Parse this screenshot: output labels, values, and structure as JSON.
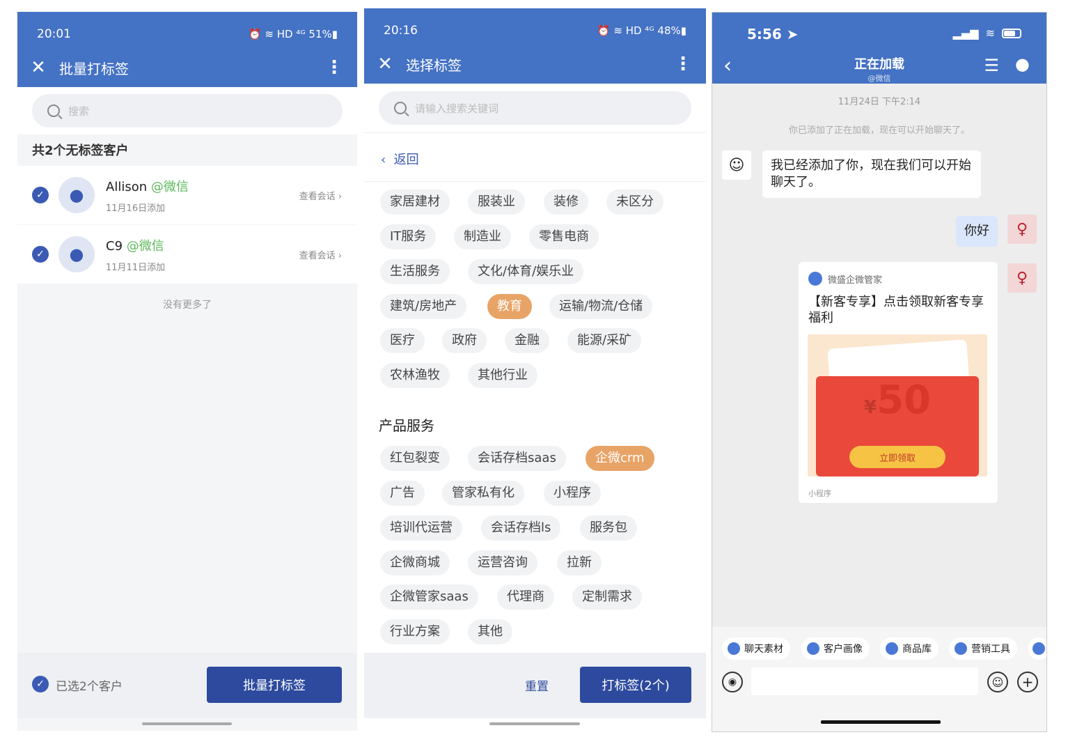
{
  "panel1": {
    "status": {
      "time": "20:01",
      "icons": "⏰ ≋ HD ⁴ᴳ 51%▮"
    },
    "title": "批量打标签",
    "search_placeholder": "搜索",
    "count_text": "共2个无标签客户",
    "customers": [
      {
        "name": "Allison",
        "source": "@微信",
        "added": "11月16日添加",
        "action": "查看会话"
      },
      {
        "name": "C9",
        "source": "@微信",
        "added": "11月11日添加",
        "action": "查看会话"
      }
    ],
    "no_more": "没有更多了",
    "selected": "已选2个客户",
    "batch_button": "批量打标签"
  },
  "panel2": {
    "status": {
      "time": "20:16",
      "icons": "⏰ ≋ HD ⁴ᴳ 48%▮"
    },
    "title": "选择标签",
    "search_placeholder": "请输入搜索关键词",
    "back": "返回",
    "industry_tags": [
      "家居建材",
      "服装业",
      "装修",
      "未区分",
      "IT服务",
      "制造业",
      "零售电商",
      "生活服务",
      "文化/体育/娱乐业",
      "建筑/房地产",
      "教育",
      "运输/物流/仓储",
      "医疗",
      "政府",
      "金融",
      "能源/采矿",
      "农林渔牧",
      "其他行业"
    ],
    "section_title": "产品服务",
    "product_tags": [
      "红包裂变",
      "会话存档saas",
      "企微crm",
      "广告",
      "管家私有化",
      "小程序",
      "培训代运营",
      "会话存档ls",
      "服务包",
      "企微商城",
      "运营咨询",
      "拉新",
      "企微管家saas",
      "代理商",
      "定制需求",
      "行业方案",
      "其他"
    ],
    "selected_tags": [
      "教育",
      "企微crm"
    ],
    "reset": "重置",
    "apply": "打标签(2个)"
  },
  "panel3": {
    "status": {
      "time": "5:56"
    },
    "title": "正在加载",
    "subtitle": "@微信",
    "timestamp": "11月24日 下午2:14",
    "system_msg": "你已添加了正在加载，现在可以开始聊天了。",
    "msg_in": "我已经添加了你，现在我们可以开始聊天了。",
    "msg_out": "你好",
    "card": {
      "brand": "微盛企微管家",
      "title": "【新客专享】点击领取新客专享福利",
      "currency": "¥",
      "amount": "50",
      "claim": "立即领取",
      "footer": "小程序"
    },
    "toolbar": [
      "聊天素材",
      "客户画像",
      "商品库",
      "营销工具"
    ],
    "accent": "#4472c4",
    "primary_btn": "#2d4a9e",
    "tag_selected": "#e8a366"
  }
}
